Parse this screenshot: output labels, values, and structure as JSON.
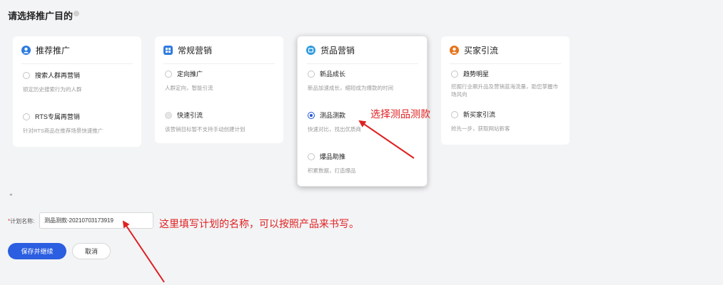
{
  "page_title": "请选择推广目的",
  "colors": {
    "accent": "#2b5ee0",
    "annotation": "#e02020",
    "icon_blue": "#2f7be0",
    "icon_orange": "#e8731a"
  },
  "cards": [
    {
      "title": "推荐推广",
      "icon": "user-circle-icon",
      "options": [
        {
          "label": "搜索人群再营销",
          "desc": "锁定历史搜索行为的人群",
          "state": "unchecked"
        },
        {
          "label": "RTS专属再营销",
          "desc": "针对RTS商品在推荐场景快速推广",
          "state": "unchecked"
        }
      ]
    },
    {
      "title": "常规营销",
      "icon": "grid-box-icon",
      "options": [
        {
          "label": "定向推广",
          "desc": "人群定向，智能引流",
          "state": "unchecked"
        },
        {
          "label": "快速引流",
          "desc": "该营销目标暂不支持手动创建计划",
          "state": "disabled"
        }
      ]
    },
    {
      "title": "货品营销",
      "icon": "box-circle-icon",
      "options": [
        {
          "label": "新品成长",
          "desc": "新品加速成长，缩短成为爆款的时间",
          "state": "unchecked"
        },
        {
          "label": "测品测款",
          "desc": "快速对比，找出优质商",
          "state": "checked"
        },
        {
          "label": "爆品助推",
          "desc": "积累数据，打造爆品",
          "state": "unchecked"
        }
      ]
    },
    {
      "title": "买家引流",
      "icon": "person-circle-icon",
      "options": [
        {
          "label": "趋势明星",
          "desc1": "挖掘行业飙升品及营销蓝海流量，助您掌握市",
          "desc2": "场风向",
          "state": "unchecked"
        },
        {
          "label": "新买家引流",
          "desc": "抢先一步，获取网站新客",
          "state": "unchecked"
        }
      ]
    }
  ],
  "collapse_arrow": "◂",
  "plan_name": {
    "required_mark": "*",
    "label": "计划名称:",
    "value": "测品测款-20210703173919"
  },
  "buttons": {
    "save": "保存并继续",
    "cancel": "取消"
  },
  "annotations": {
    "select_hint": "选择测品测款",
    "name_hint": "这里填写计划的名称，可以按照产品来书写。"
  }
}
